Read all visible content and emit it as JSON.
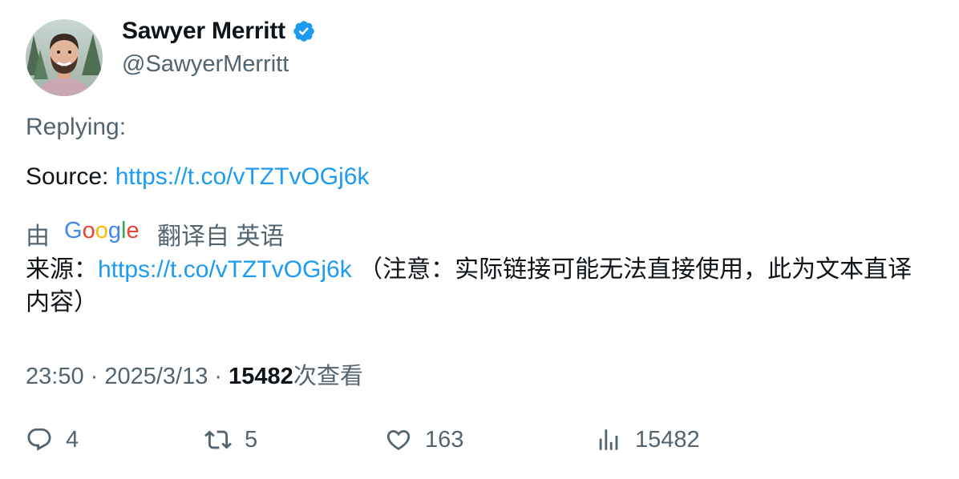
{
  "author": {
    "name": "Sawyer Merritt",
    "handle": "@SawyerMerritt"
  },
  "tweet": {
    "replying_label": "Replying:",
    "source_label": "Source: ",
    "source_link": "https://t.co/vTZTvOGj6k"
  },
  "translation": {
    "prefix": "由",
    "provider": "Google",
    "suffix": "翻译自 英语",
    "label": "来源：",
    "link": "https://t.co/vTZTvOGj6k",
    "note": " （注意：实际链接可能无法直接使用，此为文本直译内容）"
  },
  "meta": {
    "time": "23:50",
    "sep1": " · ",
    "date": "2025/3/13",
    "sep2": " · ",
    "views_count": "15482",
    "views_label": "次查看"
  },
  "actions": {
    "replies": "4",
    "retweets": "5",
    "likes": "163",
    "views": "15482"
  },
  "colors": {
    "link": "#1d9bf0",
    "secondary_text": "#536471",
    "primary_text": "#0f1419",
    "verified_badge": "#1d9bf0"
  },
  "icons": [
    "verified-badge-icon",
    "reply-icon",
    "retweet-icon",
    "like-icon",
    "views-icon"
  ]
}
